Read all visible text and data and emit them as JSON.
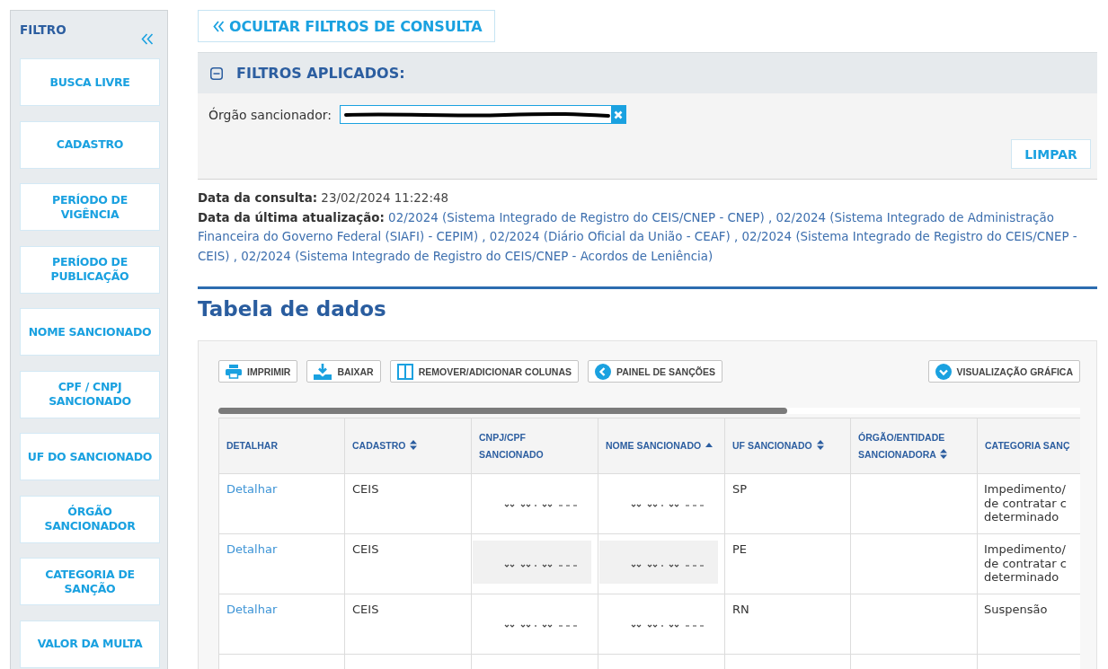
{
  "sidebar": {
    "title": "FILTRO",
    "items": [
      {
        "label": "BUSCA LIVRE"
      },
      {
        "label": "CADASTRO"
      },
      {
        "label": "PERÍODO DE VIGÊNCIA"
      },
      {
        "label": "PERÍODO DE PUBLICAÇÃO"
      },
      {
        "label": "NOME SANCIONADO"
      },
      {
        "label": "CPF / CNPJ SANCIONADO"
      },
      {
        "label": "UF DO SANCIONADO"
      },
      {
        "label": "ÓRGÃO SANCIONADOR"
      },
      {
        "label": "CATEGORIA DE SANÇÃO"
      },
      {
        "label": "VALOR DA MULTA"
      }
    ]
  },
  "hide_filters_button": {
    "label": "OCULTAR FILTROS DE CONSULTA"
  },
  "applied_filters": {
    "title": "FILTROS APLICADOS:",
    "expanded": true,
    "filters": [
      {
        "label": "Órgão sancionador:",
        "chip": {
          "redacted": true
        }
      }
    ],
    "clear_button": "LIMPAR"
  },
  "query_info": [
    {
      "kind": "plain",
      "label": "Data da consulta:",
      "value": "23/02/2024 11:22:48"
    },
    {
      "kind": "link",
      "label": "Data da última atualização:",
      "value": "02/2024 (Sistema Integrado de Registro do CEIS/CNEP - CNEP) , 02/2024 (Sistema Integrado de Administração Financeira do Governo Federal (SIAFI) - CEPIM) , 02/2024 (Diário Oficial da União - CEAF) , 02/2024 (Sistema Integrado de Registro do CEIS/CNEP - CEIS) , 02/2024 (Sistema Integrado de Registro do CEIS/CNEP - Acordos de Leniência)"
    }
  ],
  "section_title": "Tabela de dados",
  "toolbar": {
    "left": [
      {
        "kind": "print",
        "label": "IMPRIMIR"
      },
      {
        "kind": "download",
        "label": "BAIXAR"
      },
      {
        "kind": "columns",
        "label": "REMOVER/ADICIONAR COLUNAS"
      },
      {
        "kind": "back",
        "label": "PAINEL DE SANÇÕES"
      }
    ],
    "right": [
      {
        "kind": "expand",
        "label": "VISUALIZAÇÃO GRÁFICA"
      }
    ]
  },
  "table": {
    "columns": [
      {
        "label": "DETALHAR",
        "sortable": false,
        "sorted": false
      },
      {
        "label": "CADASTRO",
        "sortable": true,
        "sorted": false
      },
      {
        "label": "CNPJ/CPF SANCIONADO",
        "sortable": false,
        "sorted": false
      },
      {
        "label": "NOME SANCIONADO",
        "sortable": true,
        "sorted": true
      },
      {
        "label": "UF SANCIONADO",
        "sortable": true,
        "sorted": false
      },
      {
        "label": "ÓRGÃO/ENTIDADE SANCIONADORA",
        "sortable": true,
        "sorted": false
      },
      {
        "label": "CATEGORIA SANÇ",
        "sortable": false,
        "sorted": false
      }
    ],
    "rows": [
      {
        "detalhar": "Detalhar",
        "cadastro": "CEIS",
        "cnpj_cpf_sancionado": {
          "redacted": true,
          "shaded": false
        },
        "nome_sancionado": {
          "redacted": true,
          "shaded": false
        },
        "uf_sancionado": "SP",
        "categoria_sancao": [
          "Impedimento/",
          "de contratar c",
          "determinado"
        ]
      },
      {
        "detalhar": "Detalhar",
        "cadastro": "CEIS",
        "cnpj_cpf_sancionado": {
          "redacted": true,
          "shaded": true
        },
        "nome_sancionado": {
          "redacted": true,
          "shaded": true
        },
        "uf_sancionado": "PE",
        "categoria_sancao": [
          "Impedimento/",
          "de contratar c",
          "determinado"
        ]
      },
      {
        "detalhar": "Detalhar",
        "cadastro": "CEIS",
        "cnpj_cpf_sancionado": {
          "redacted": true,
          "shaded": false
        },
        "nome_sancionado": {
          "redacted": true,
          "shaded": false
        },
        "uf_sancionado": "RN",
        "categoria_sancao": [
          "Suspensão"
        ]
      }
    ]
  }
}
